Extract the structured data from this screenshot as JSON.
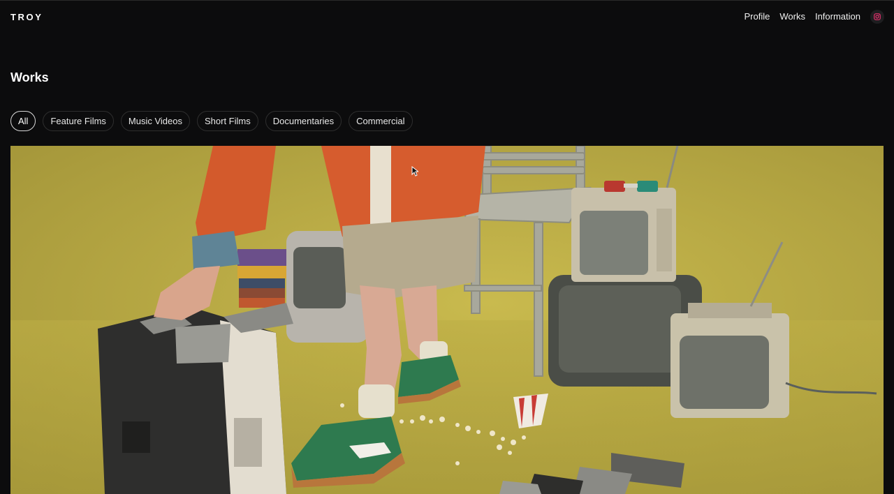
{
  "header": {
    "logo": "TROY",
    "nav": [
      {
        "label": "Profile"
      },
      {
        "label": "Works"
      },
      {
        "label": "Information"
      }
    ],
    "instagram_icon": "instagram-icon"
  },
  "main": {
    "title": "Works",
    "filters": [
      {
        "label": "All",
        "active": true
      },
      {
        "label": "Feature Films",
        "active": false
      },
      {
        "label": "Music Videos",
        "active": false
      },
      {
        "label": "Short Films",
        "active": false
      },
      {
        "label": "Documentaries",
        "active": false
      },
      {
        "label": "Commercial",
        "active": false
      }
    ]
  },
  "colors": {
    "background": "#0c0c0d",
    "text": "#ffffff",
    "instagram_accent": "#e1306c"
  }
}
